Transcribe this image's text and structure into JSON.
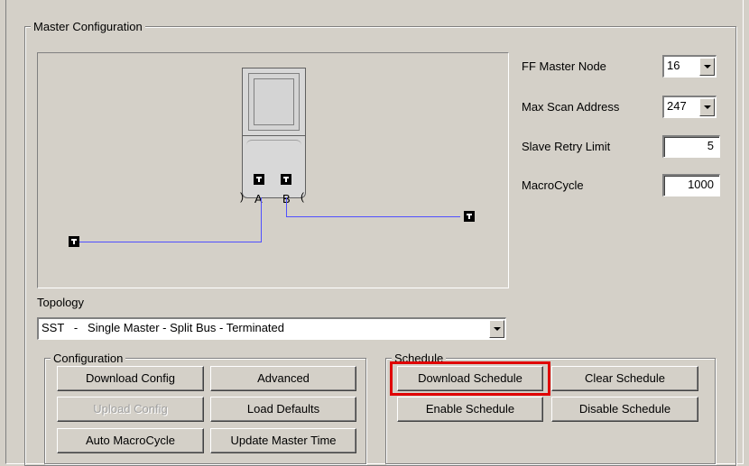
{
  "master_group": {
    "legend": "Master Configuration",
    "ff_master_node_label": "FF Master Node",
    "ff_master_node_value": "16",
    "max_scan_address_label": "Max Scan Address",
    "max_scan_address_value": "247",
    "slave_retry_limit_label": "Slave Retry Limit",
    "slave_retry_limit_value": "5",
    "macrocycle_label": "MacroCycle",
    "macrocycle_value": "1000"
  },
  "diagram": {
    "port_a": "A",
    "port_b": "B",
    "wire_color": "#5050ff",
    "terminator_icon": "terminator-icon"
  },
  "topology": {
    "label": "Topology",
    "selected": "SST   -   Single Master - Split Bus - Terminated"
  },
  "configuration": {
    "legend": "Configuration",
    "download_config": "Download Config",
    "advanced": "Advanced",
    "upload_config": "Upload Config",
    "load_defaults": "Load Defaults",
    "auto_macrocycle": "Auto MacroCycle",
    "update_master_time": "Update Master Time"
  },
  "schedule": {
    "legend": "Schedule",
    "download_schedule": "Download Schedule",
    "clear_schedule": "Clear Schedule",
    "enable_schedule": "Enable Schedule",
    "disable_schedule": "Disable Schedule",
    "highlight_color": "#e00000"
  }
}
